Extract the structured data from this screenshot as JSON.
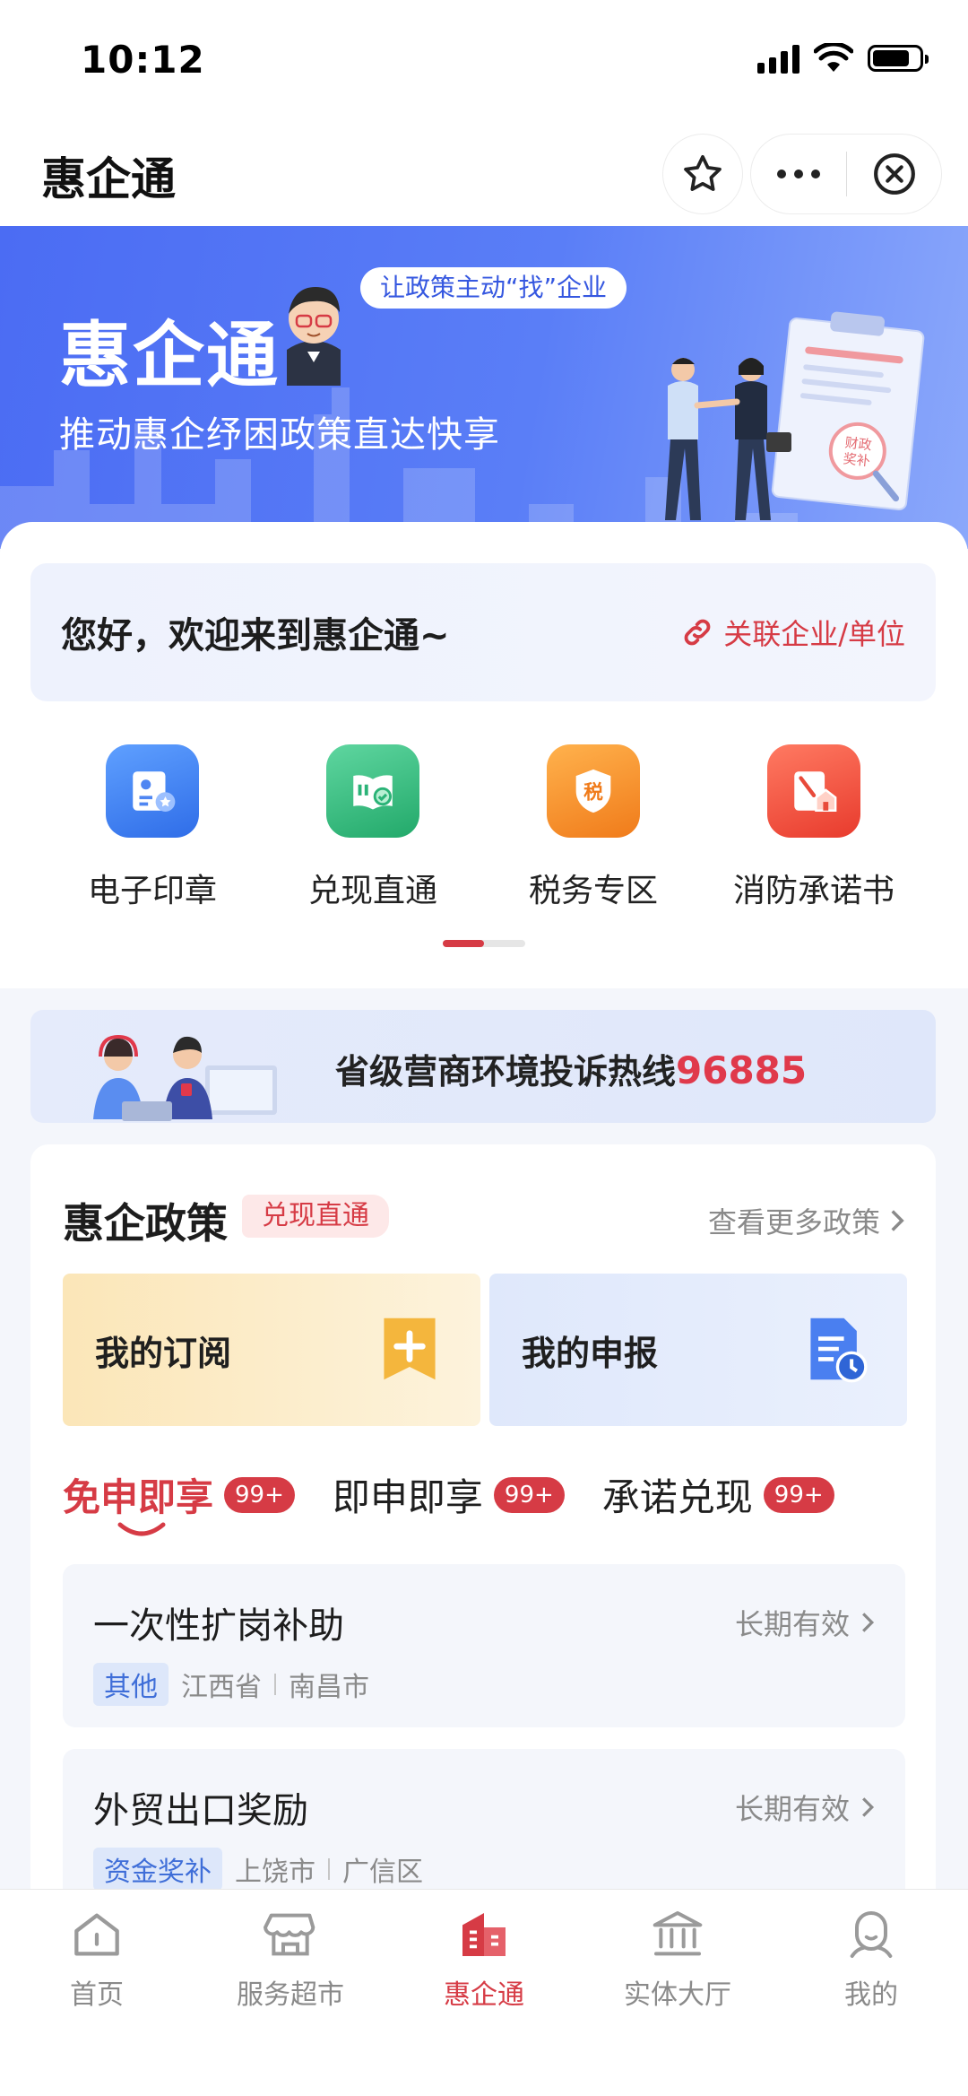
{
  "status_bar": {
    "time": "10:12"
  },
  "navbar": {
    "title": "惠企通",
    "star_icon": "star-icon",
    "more_icon": "more-icon",
    "close_icon": "close-circle-icon"
  },
  "banner": {
    "title": "惠企通",
    "subtitle": "推动惠企纾困政策直达快享",
    "tag": "让政策主动“找”企业",
    "art_stamp": "财政奖补"
  },
  "welcome": {
    "text": "您好，欢迎来到惠企通~",
    "link_label": "关联企业/单位"
  },
  "quick_actions": [
    {
      "label": "电子印章",
      "icon": "e-seal-icon",
      "color": "#3d7ef5"
    },
    {
      "label": "兑现直通",
      "icon": "cash-direct-icon",
      "color": "#30b97d"
    },
    {
      "label": "税务专区",
      "icon": "tax-icon",
      "color": "#f58a25",
      "glyph": "税"
    },
    {
      "label": "消防承诺书",
      "icon": "fire-pledge-icon",
      "color": "#f0503e"
    }
  ],
  "hotline": {
    "text": "省级营商环境投诉热线",
    "number": "96885"
  },
  "policy": {
    "title": "惠企政策",
    "tag": "兑现直通",
    "more": "查看更多政策",
    "cards": [
      {
        "label": "我的订阅",
        "icon": "subscribe-icon"
      },
      {
        "label": "我的申报",
        "icon": "declare-icon"
      }
    ],
    "tabs": [
      {
        "label": "免申即享",
        "badge": "99+"
      },
      {
        "label": "即申即享",
        "badge": "99+"
      },
      {
        "label": "承诺兑现",
        "badge": "99+"
      }
    ],
    "items": [
      {
        "name": "一次性扩岗补助",
        "validity": "长期有效",
        "category": "其他",
        "province": "江西省",
        "city": "南昌市"
      },
      {
        "name": "外贸出口奖励",
        "validity": "长期有效",
        "category": "资金奖补",
        "province": "上饶市",
        "city": "广信区"
      }
    ]
  },
  "tabbar": [
    {
      "label": "首页",
      "icon": "home-icon"
    },
    {
      "label": "服务超市",
      "icon": "store-icon"
    },
    {
      "label": "惠企通",
      "icon": "building-icon",
      "active": true
    },
    {
      "label": "实体大厅",
      "icon": "hall-icon"
    },
    {
      "label": "我的",
      "icon": "profile-icon"
    }
  ],
  "colors": {
    "accent_red": "#d63b45",
    "banner_blue": "#4b6cf3"
  }
}
